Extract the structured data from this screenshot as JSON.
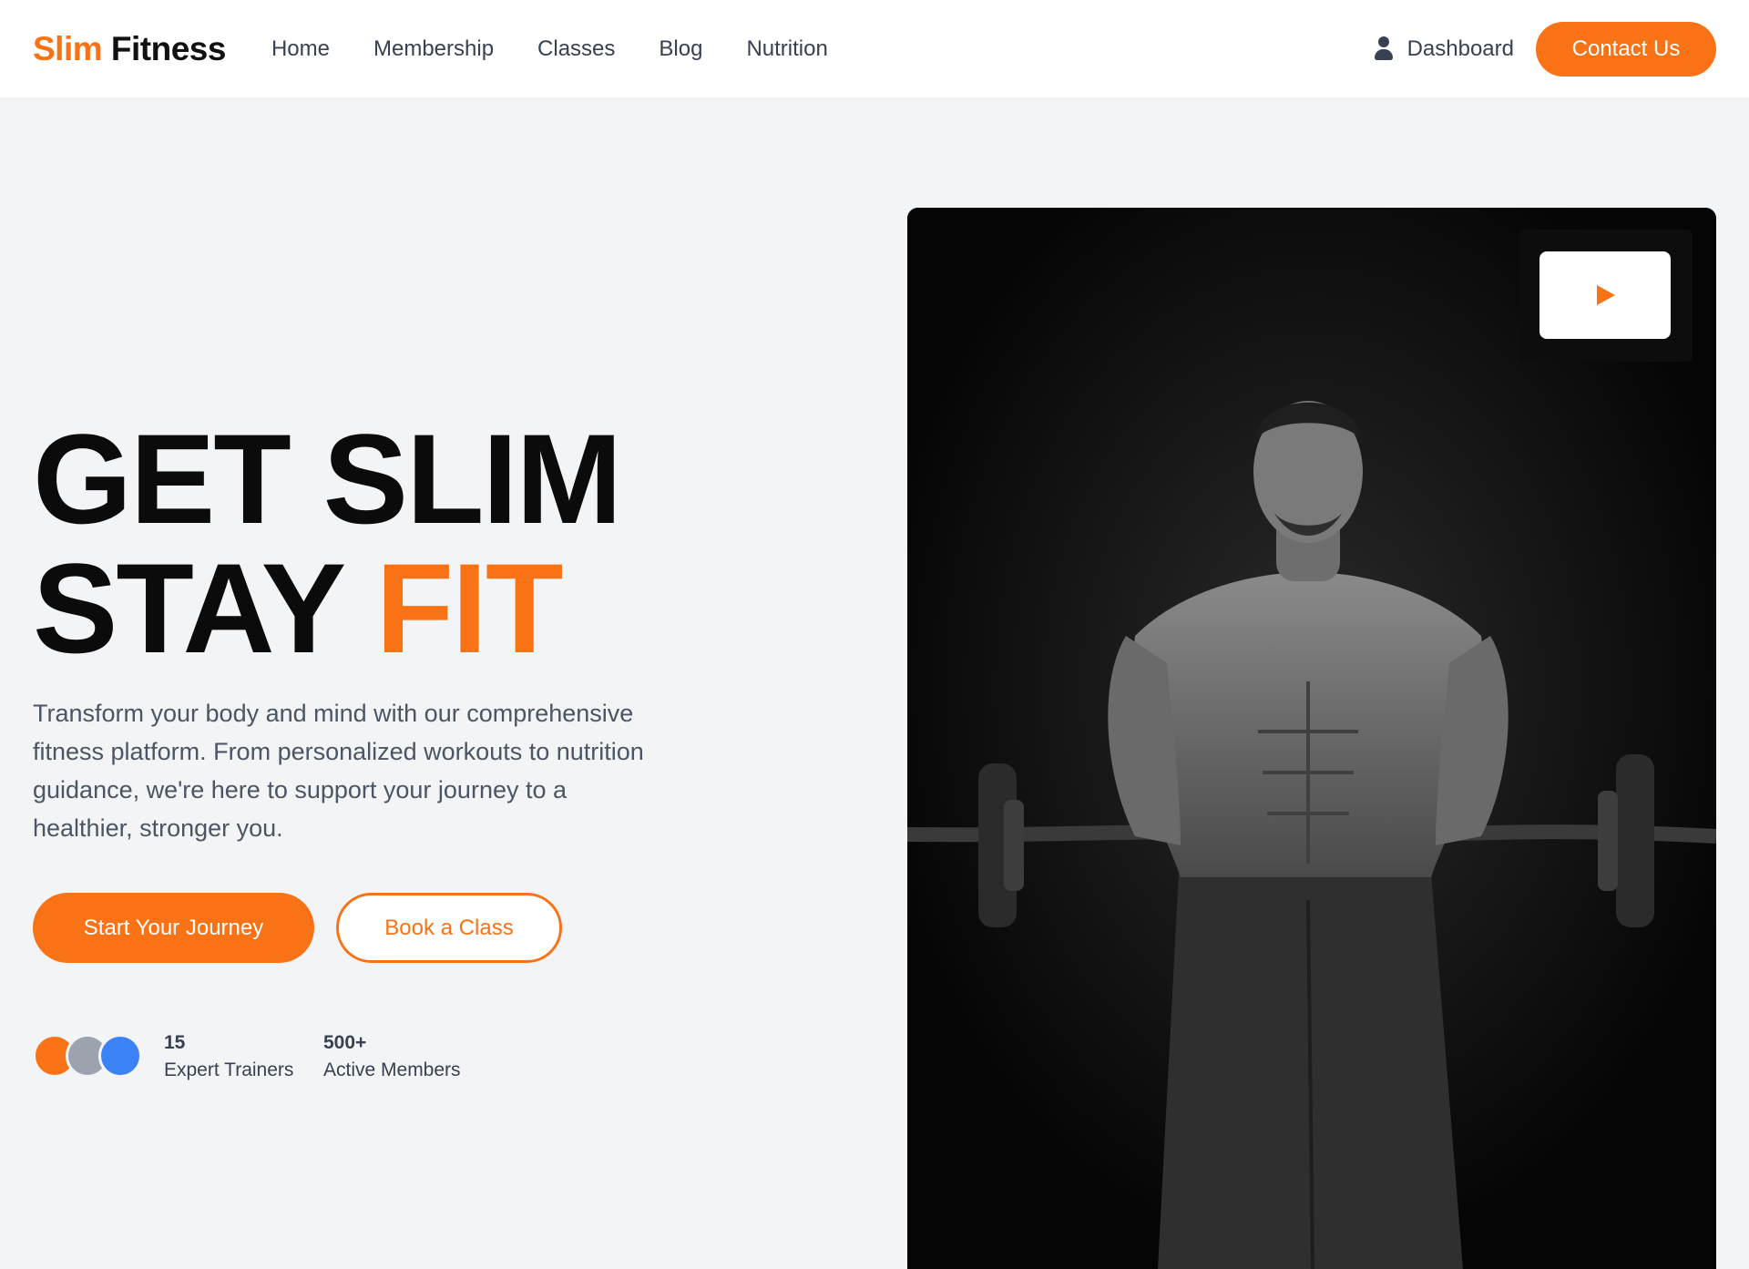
{
  "brand": {
    "first": "Slim",
    "second": "Fitness"
  },
  "nav": [
    "Home",
    "Membership",
    "Classes",
    "Blog",
    "Nutrition"
  ],
  "header": {
    "dashboard_label": "Dashboard",
    "contact_label": "Contact Us"
  },
  "hero": {
    "line1": "GET SLIM",
    "line2_plain": "STAY",
    "line2_accent": "FIT",
    "description": "Transform your body and mind with our comprehensive fitness platform. From personalized workouts to nutrition guidance, we're here to support your journey to a healthier, stronger you.",
    "primary_cta": "Start Your Journey",
    "secondary_cta": "Book a Class"
  },
  "stats": [
    {
      "value": "15",
      "label": "Expert Trainers"
    },
    {
      "value": "500+",
      "label": "Active Members"
    }
  ],
  "avatar_colors": [
    "#f97316",
    "#9ca3af",
    "#3b82f6"
  ],
  "colors": {
    "accent": "#f97316",
    "background": "#f3f4f6",
    "text": "#0b0b0b"
  }
}
